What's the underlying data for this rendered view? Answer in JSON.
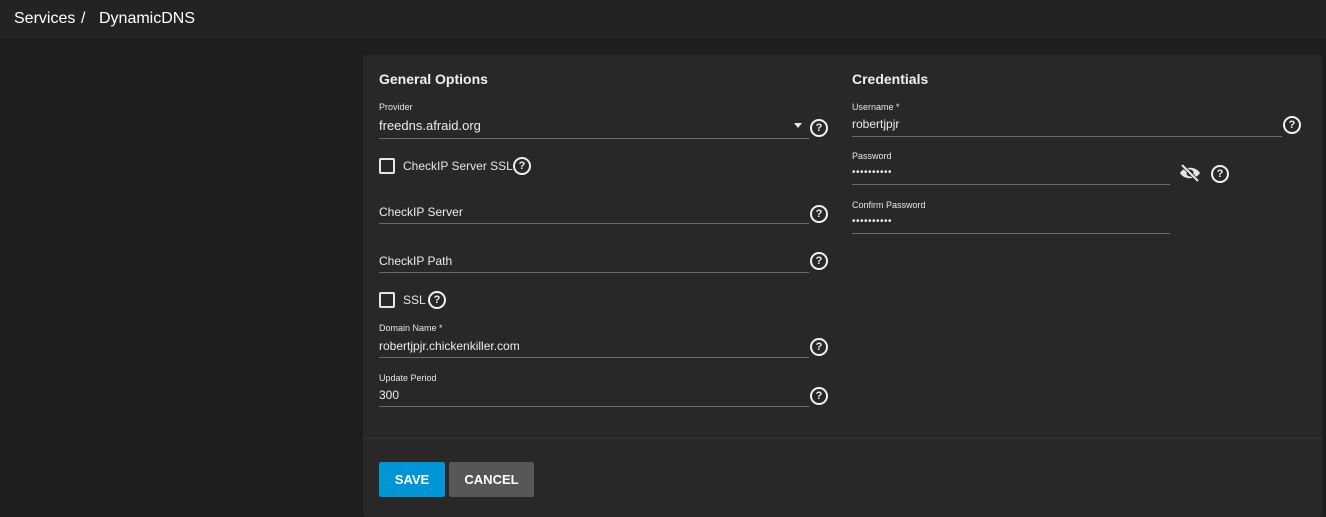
{
  "breadcrumb": {
    "services": "Services",
    "separator": "/",
    "current": "DynamicDNS"
  },
  "general": {
    "title": "General Options",
    "provider": {
      "label": "Provider",
      "value": "freedns.afraid.org"
    },
    "checkip_ssl": {
      "label": "CheckIP Server SSL",
      "checked": false
    },
    "checkip_server": {
      "label": "CheckIP Server",
      "value": ""
    },
    "checkip_path": {
      "label": "CheckIP Path",
      "value": ""
    },
    "ssl": {
      "label": "SSL",
      "checked": false
    },
    "domain": {
      "label": "Domain Name *",
      "value": "robertjpjr.chickenkiller.com"
    },
    "period": {
      "label": "Update Period",
      "value": "300"
    }
  },
  "credentials": {
    "title": "Credentials",
    "username": {
      "label": "Username *",
      "value": "robertjpjr"
    },
    "password": {
      "label": "Password",
      "value": "••••••••••"
    },
    "confirm": {
      "label": "Confirm Password",
      "value": "••••••••••"
    }
  },
  "actions": {
    "save": "SAVE",
    "cancel": "CANCEL"
  },
  "icons": {
    "help": "help-circle-icon",
    "visibility": "eye-off-icon",
    "dropdown": "caret-down-icon"
  },
  "colors": {
    "primary": "#0095d5",
    "cancel": "#575757",
    "background": "#1e1e1e",
    "card": "#282828"
  },
  "help_glyph": "?"
}
